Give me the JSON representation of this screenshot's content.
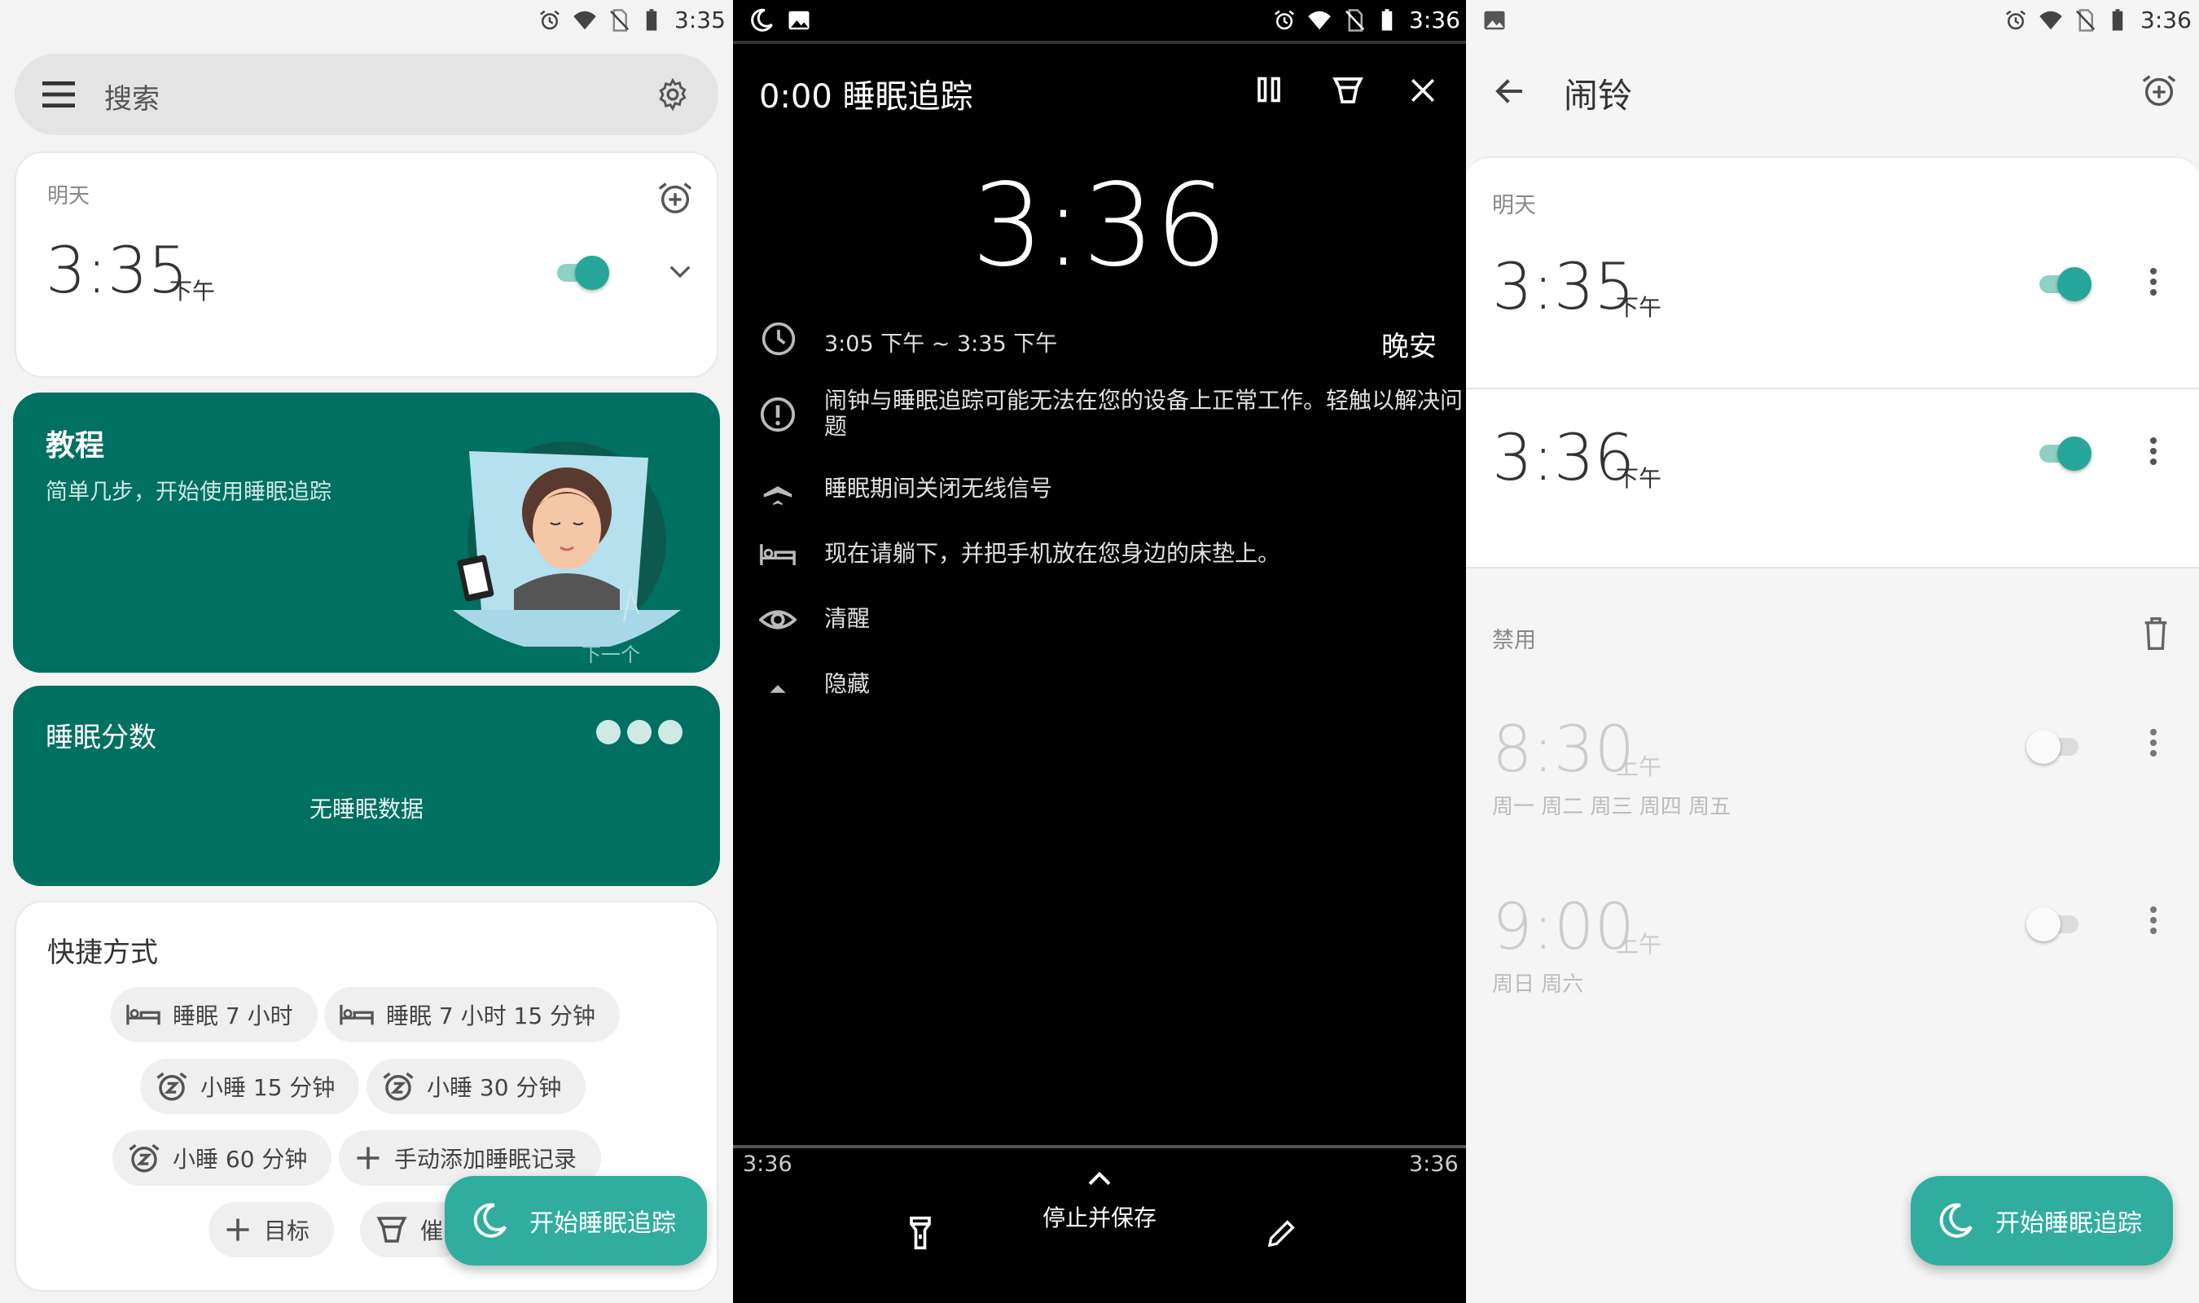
{
  "panel1": {
    "status_time": "3:35",
    "search_placeholder": "搜索",
    "alarm_card": {
      "day_label": "明天",
      "time": "3:35",
      "ampm": "下午",
      "enabled": true
    },
    "tutorial_card": {
      "title": "教程",
      "subtitle": "简单几步，开始使用睡眠追踪",
      "next_label": "下一个"
    },
    "sleep_score_card": {
      "title": "睡眠分数",
      "empty_text": "无睡眠数据"
    },
    "shortcuts": {
      "title": "快捷方式",
      "items": [
        {
          "label": "睡眠 7 小时",
          "icon": "bed-icon"
        },
        {
          "label": "睡眠 7 小时 15 分钟",
          "icon": "bed-icon"
        },
        {
          "label": "小睡 15 分钟",
          "icon": "nap-alarm-icon"
        },
        {
          "label": "小睡 30 分钟",
          "icon": "nap-alarm-icon"
        },
        {
          "label": "小睡 60 分钟",
          "icon": "nap-alarm-icon"
        },
        {
          "label": "手动添加睡眠记录",
          "icon": "plus-icon"
        },
        {
          "label": "目标",
          "icon": "plus-icon"
        },
        {
          "label": "催",
          "icon": "lullaby-icon"
        }
      ]
    },
    "fab_label": "开始睡眠追踪",
    "accent_color": "#007060"
  },
  "panel2": {
    "status_time": "3:36",
    "header_title": "0:00 睡眠追踪",
    "clock": "3:36",
    "time_range": "3:05 下午 ~ 3:35 下午",
    "goodnight": "晚安",
    "items": [
      {
        "icon": "warning-icon",
        "text": "闹钟与睡眠追踪可能无法在您的设备上正常工作。轻触以解决问题"
      },
      {
        "icon": "airplane-icon",
        "text": "睡眠期间关闭无线信号"
      },
      {
        "icon": "bed-icon",
        "text": "现在请躺下，并把手机放在您身边的床垫上。"
      },
      {
        "icon": "eye-icon",
        "text": "清醒"
      },
      {
        "icon": "caret-up-icon",
        "text": "隐藏"
      }
    ],
    "bottom_left_time": "3:36",
    "bottom_right_time": "3:36",
    "stop_save_label": "停止并保存"
  },
  "panel3": {
    "status_time": "3:36",
    "title": "闹铃",
    "section_enabled": "明天",
    "alarms": [
      {
        "time": "3:35",
        "ampm": "下午",
        "enabled": true,
        "days": ""
      },
      {
        "time": "3:36",
        "ampm": "下午",
        "enabled": true,
        "days": ""
      }
    ],
    "section_disabled": "禁用",
    "disabled_alarms": [
      {
        "time": "8:30",
        "ampm": "上午",
        "enabled": false,
        "days": "周一 周二 周三 周四 周五"
      },
      {
        "time": "9:00",
        "ampm": "上午",
        "enabled": false,
        "days": "周日 周六"
      }
    ],
    "fab_label": "开始睡眠追踪"
  }
}
